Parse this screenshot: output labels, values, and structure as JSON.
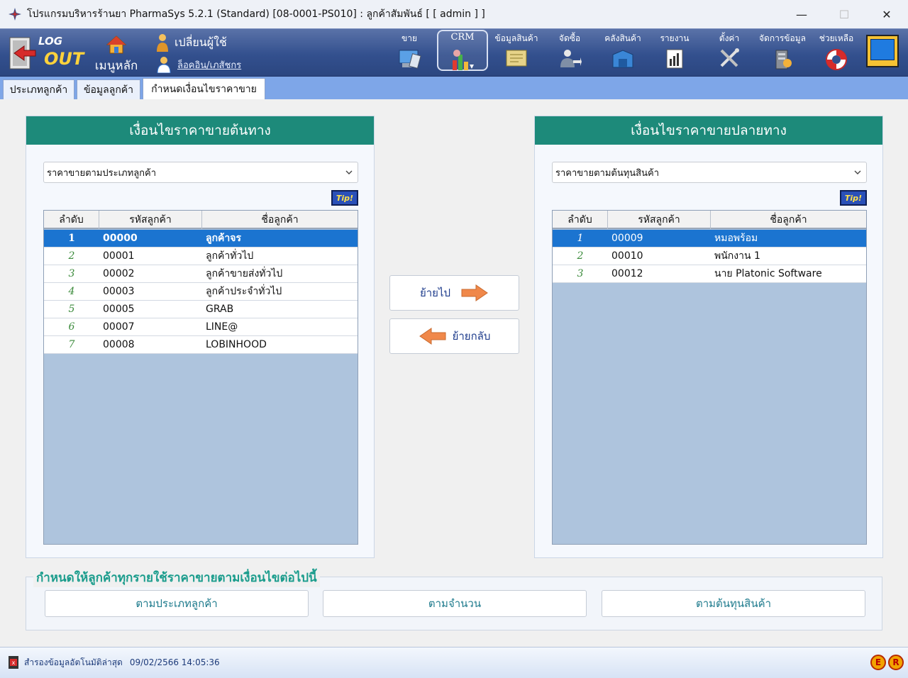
{
  "window": {
    "title": "โปรแกรมบริหารร้านยา PharmaSys 5.2.1 (Standard) [08-0001-PS010] : ลูกค้าสัมพันธ์  [ [ admin ] ]",
    "minimize": "—",
    "maximize": "☐",
    "close": "✕"
  },
  "toolbar": {
    "logout_top": "LOG",
    "logout_bottom": "OUT",
    "home_label": "เมนูหลัก",
    "switch_user": "เปลี่ยนผู้ใช้",
    "login_member": "ล็อคอิน/เภสัชกร",
    "items": [
      {
        "label": "ขาย",
        "icon": "pos-icon"
      },
      {
        "label": "CRM",
        "icon": "crm-chart-icon"
      },
      {
        "label": "ข้อมูลสินค้า",
        "icon": "product-data-icon"
      },
      {
        "label": "จัดซื้อ",
        "icon": "purchase-icon"
      },
      {
        "label": "คลังสินค้า",
        "icon": "warehouse-icon"
      },
      {
        "label": "รายงาน",
        "icon": "report-icon"
      },
      {
        "label": "ตั้งค่า",
        "icon": "settings-tools-icon"
      },
      {
        "label": "จัดการข้อมูล",
        "icon": "data-manage-icon"
      },
      {
        "label": "ช่วยเหลือ",
        "icon": "help-lifebuoy-icon"
      }
    ]
  },
  "tabs": [
    {
      "label": "ประเภทลูกค้า",
      "active": false
    },
    {
      "label": "ข้อมูลลูกค้า",
      "active": false
    },
    {
      "label": "กำหนดเงื่อนไขราคาขาย",
      "active": true
    }
  ],
  "left_panel": {
    "title": "เงื่อนไขราคาขายต้นทาง",
    "select_value": "ราคาขายตามประเภทลูกค้า",
    "tip": "Tip!",
    "columns": [
      "ลำดับ",
      "รหัสลูกค้า",
      "ชื่อลูกค้า"
    ],
    "rows": [
      {
        "no": "1",
        "code": "00000",
        "name": "ลูกค้าจร",
        "selected": true
      },
      {
        "no": "2",
        "code": "00001",
        "name": "ลูกค้าทั่วไป",
        "selected": false
      },
      {
        "no": "3",
        "code": "00002",
        "name": "ลูกค้าขายส่งทั่วไป",
        "selected": false
      },
      {
        "no": "4",
        "code": "00003",
        "name": "ลูกค้าประจำทั่วไป",
        "selected": false
      },
      {
        "no": "5",
        "code": "00005",
        "name": "GRAB",
        "selected": false
      },
      {
        "no": "6",
        "code": "00007",
        "name": "LINE@",
        "selected": false
      },
      {
        "no": "7",
        "code": "00008",
        "name": "LOBINHOOD",
        "selected": false
      }
    ]
  },
  "right_panel": {
    "title": "เงื่อนไขราคาขายปลายทาง",
    "select_value": "ราคาขายตามต้นทุนสินค้า",
    "tip": "Tip!",
    "columns": [
      "ลำดับ",
      "รหัสลูกค้า",
      "ชื่อลูกค้า"
    ],
    "rows": [
      {
        "no": "1",
        "code": "00009",
        "name": "หมอพร้อม",
        "selected": true
      },
      {
        "no": "2",
        "code": "00010",
        "name": "พนักงาน 1",
        "selected": false
      },
      {
        "no": "3",
        "code": "00012",
        "name": "นาย Platonic Software",
        "selected": false
      }
    ]
  },
  "move_forward": "ย้ายไป",
  "move_back": "ย้ายกลับ",
  "bulk_group": {
    "title": "กำหนดให้ลูกค้าทุกรายใช้ราคาขายตามเงื่อนไขต่อไปนี้",
    "buttons": [
      "ตามประเภทลูกค้า",
      "ตามจำนวน",
      "ตามต้นทุนสินค้า"
    ]
  },
  "status": {
    "backup_label": "สำรองข้อมูลอัตโนมัติล่าสุด",
    "backup_datetime": "09/02/2566 14:05:36",
    "badge_e": "E",
    "badge_r": "R"
  },
  "colors": {
    "toolbar": "#33508e",
    "panel_header": "#1d8a7a",
    "selected_row": "#1b74d0",
    "grid_bg": "#aec4dd",
    "tabstrip": "#7ea6e8"
  }
}
